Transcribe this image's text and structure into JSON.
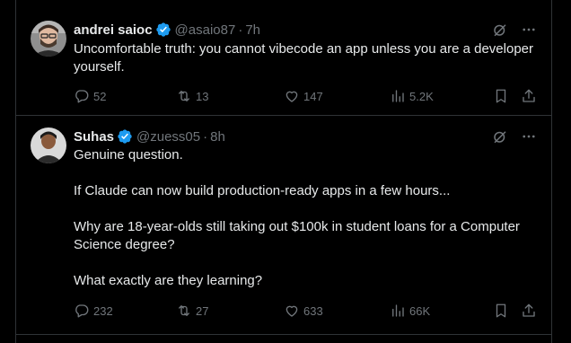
{
  "tweets": [
    {
      "name": "andrei saioc",
      "handle": "@asaio87",
      "time": "7h",
      "text": [
        "Uncomfortable truth: you cannot vibecode an app unless you are a developer yourself."
      ],
      "replies": "52",
      "retweets": "13",
      "likes": "147",
      "views": "5.2K"
    },
    {
      "name": "Suhas",
      "handle": "@zuess05",
      "time": "8h",
      "text": [
        "Genuine question.",
        "If Claude can now build production-ready apps in a few hours...",
        "Why are 18-year-olds still taking out $100k in student loans for a Computer Science degree?",
        "What exactly are they learning?"
      ],
      "replies": "232",
      "retweets": "27",
      "likes": "633",
      "views": "66K"
    }
  ],
  "icons": {
    "verified": "verified-badge-icon",
    "grok": "grok-icon",
    "more": "more-icon",
    "reply": "reply-icon",
    "retweet": "retweet-icon",
    "like": "like-icon",
    "views": "views-icon",
    "bookmark": "bookmark-icon",
    "share": "share-icon"
  },
  "colors": {
    "background": "#000000",
    "text": "#e7e9ea",
    "secondary": "#71767b",
    "border": "#2f3336",
    "verified": "#1d9bf0"
  }
}
